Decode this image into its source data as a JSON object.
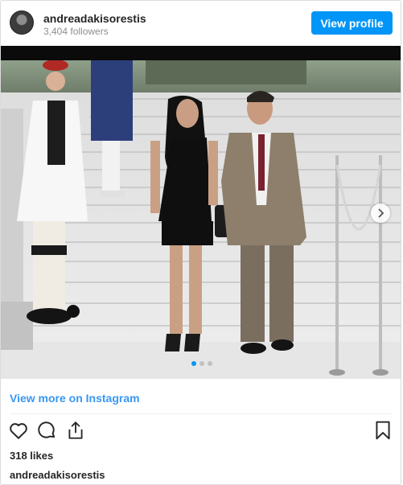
{
  "header": {
    "username": "andreadakisorestis",
    "followers": "3,404 followers",
    "view_profile_label": "View profile"
  },
  "media": {
    "carousel_dots": 3,
    "active_dot": 1
  },
  "footer": {
    "view_more_label": "View more on Instagram",
    "likes": "318 likes",
    "caption_username": "andreadakisorestis"
  },
  "icons": {
    "like": "heart-icon",
    "comment": "comment-icon",
    "share": "share-icon",
    "save": "bookmark-icon",
    "next": "chevron-right-icon"
  },
  "colors": {
    "accent": "#0095f6",
    "link": "#3897f0",
    "text": "#262626",
    "muted": "#8e8e8e"
  }
}
